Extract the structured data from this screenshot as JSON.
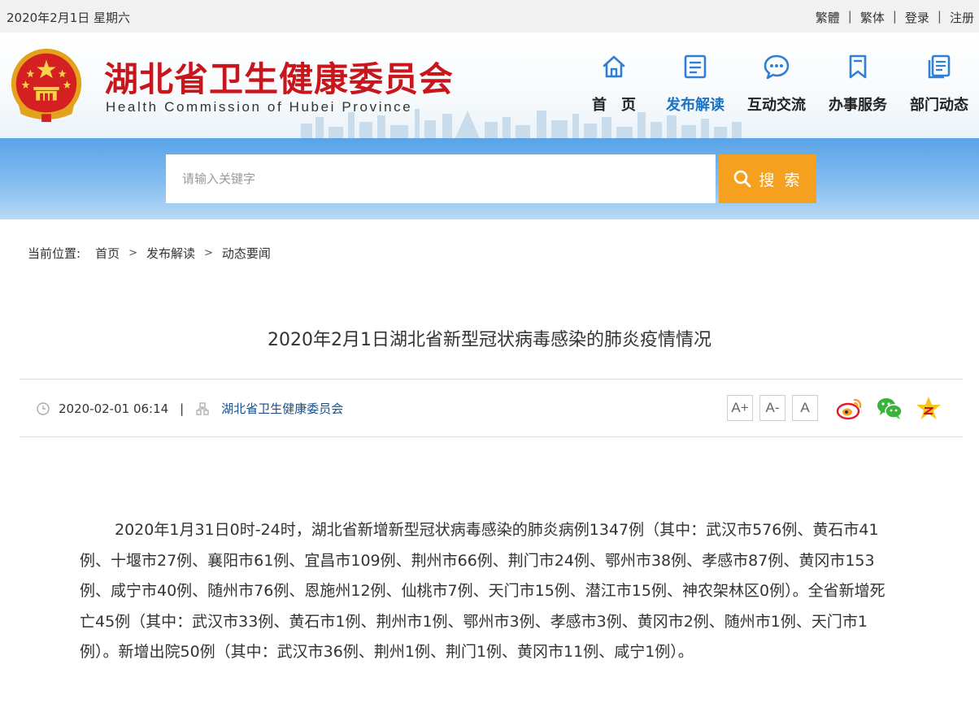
{
  "topbar": {
    "date": "2020年2月1日 星期六",
    "links": [
      "繁體",
      "繁体",
      "登录",
      "注册"
    ],
    "separator": "|"
  },
  "header": {
    "title": "湖北省卫生健康委员会",
    "subtitle": "Health Commission of Hubei Province",
    "title_color": "#c7171c"
  },
  "nav": {
    "items": [
      {
        "label": "首　页",
        "icon": "home-icon"
      },
      {
        "label": "发布解读",
        "icon": "document-icon"
      },
      {
        "label": "互动交流",
        "icon": "chat-icon"
      },
      {
        "label": "办事服务",
        "icon": "bookmark-icon"
      },
      {
        "label": "部门动态",
        "icon": "pages-icon"
      }
    ],
    "active_index": 1,
    "icon_color": "#2f7fd3"
  },
  "search": {
    "placeholder": "请输入关键字",
    "button_label": "搜 索",
    "button_color": "#f6a020"
  },
  "breadcrumb": {
    "label": "当前位置:",
    "items": [
      "首页",
      "发布解读",
      "动态要闻"
    ],
    "separator": ">"
  },
  "article": {
    "title": "2020年2月1日湖北省新型冠状病毒感染的肺炎疫情情况",
    "datetime": "2020-02-01 06:14",
    "meta_separator": "|",
    "source": "湖北省卫生健康委员会",
    "font_buttons": [
      "A+",
      "A-",
      "A"
    ],
    "share_icons": [
      "weibo-icon",
      "wechat-icon",
      "favorite-icon"
    ],
    "body": "2020年1月31日0时-24时，湖北省新增新型冠状病毒感染的肺炎病例1347例（其中：武汉市576例、黄石市41例、十堰市27例、襄阳市61例、宜昌市109例、荆州市66例、荆门市24例、鄂州市38例、孝感市87例、黄冈市153例、咸宁市40例、随州市76例、恩施州12例、仙桃市7例、天门市15例、潜江市15例、神农架林区0例）。全省新增死亡45例（其中：武汉市33例、黄石市1例、荆州市1例、鄂州市3例、孝感市3例、黄冈市2例、随州市1例、天门市1例）。新增出院50例（其中：武汉市36例、荆州1例、荆门1例、黄冈市11例、咸宁1例）。"
  }
}
